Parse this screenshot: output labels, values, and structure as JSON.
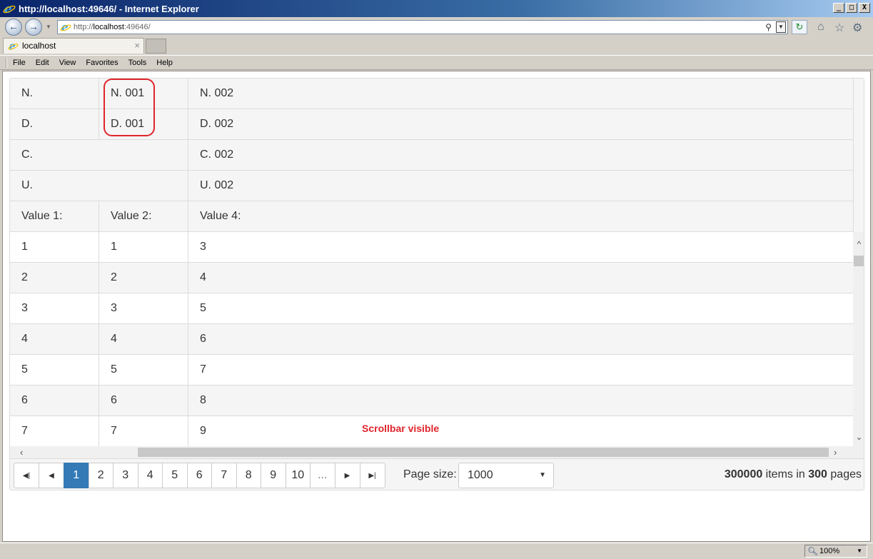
{
  "window": {
    "title": "http://localhost:49646/ - Internet Explorer",
    "buttons": {
      "minimize": "_",
      "maximize": "□",
      "close": "X"
    }
  },
  "address": {
    "url_prefix": "http://",
    "url_host": "localhost",
    "url_suffix": ":49646/"
  },
  "tab": {
    "label": "localhost",
    "close": "×"
  },
  "menu": [
    "File",
    "Edit",
    "View",
    "Favorites",
    "Tools",
    "Help"
  ],
  "grid": {
    "header_rows": [
      {
        "c1": "N.",
        "c2": "N. 001",
        "c3": "N. 002"
      },
      {
        "c1": "D.",
        "c2": "D. 001",
        "c3": "D. 002"
      },
      {
        "c12": "C.",
        "c3": "C. 002"
      },
      {
        "c12": "U.",
        "c3": "U. 002"
      },
      {
        "c1": "Value 1:",
        "c2": "Value 2:",
        "c3": "Value 4:"
      }
    ],
    "rows": [
      [
        "1",
        "1",
        "3"
      ],
      [
        "2",
        "2",
        "4"
      ],
      [
        "3",
        "3",
        "5"
      ],
      [
        "4",
        "4",
        "6"
      ],
      [
        "5",
        "5",
        "7"
      ],
      [
        "6",
        "6",
        "8"
      ],
      [
        "7",
        "7",
        "9"
      ]
    ],
    "annotation": "Scrollbar visible",
    "annotation_color": "#e0242b"
  },
  "pager": {
    "pages": [
      "1",
      "2",
      "3",
      "4",
      "5",
      "6",
      "7",
      "8",
      "9",
      "10",
      "..."
    ],
    "active_page": "1",
    "page_size_label": "Page size:",
    "page_size_value": "1000",
    "total_items": "300000",
    "items_in_text": " items in ",
    "total_pages": "300",
    "pages_text": " pages",
    "active_color": "#337ab7"
  },
  "status": {
    "zoom": "100%"
  }
}
